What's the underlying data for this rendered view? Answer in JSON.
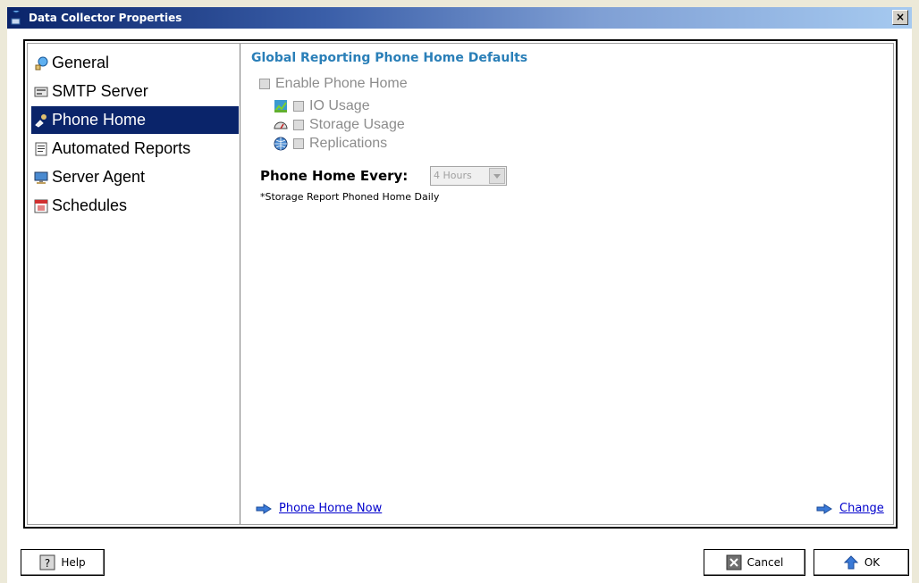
{
  "window": {
    "title": "Data Collector Properties",
    "close_label": "×"
  },
  "nav": {
    "items": [
      {
        "label": "General",
        "icon": "general-icon"
      },
      {
        "label": "SMTP Server",
        "icon": "smtp-icon"
      },
      {
        "label": "Phone Home",
        "icon": "phone-home-icon",
        "selected": true
      },
      {
        "label": "Automated Reports",
        "icon": "reports-icon"
      },
      {
        "label": "Server Agent",
        "icon": "server-agent-icon"
      },
      {
        "label": "Schedules",
        "icon": "schedules-icon"
      }
    ]
  },
  "content": {
    "heading": "Global Reporting Phone Home Defaults",
    "enable_label": "Enable Phone Home",
    "enable_checked": false,
    "options": [
      {
        "label": "IO Usage",
        "icon": "io-chart-icon",
        "checked": false
      },
      {
        "label": "Storage Usage",
        "icon": "gauge-icon",
        "checked": false
      },
      {
        "label": "Replications",
        "icon": "globe-icon",
        "checked": false
      }
    ],
    "every_label": "Phone Home Every:",
    "every_value": "4 Hours",
    "note": "*Storage Report Phoned Home Daily",
    "phone_home_now": "Phone Home Now",
    "change": "Change"
  },
  "buttons": {
    "help": "Help",
    "cancel": "Cancel",
    "ok": "OK"
  },
  "colors": {
    "heading": "#2a7fb8",
    "selected_bg": "#0a246a",
    "link": "#0000cc"
  }
}
